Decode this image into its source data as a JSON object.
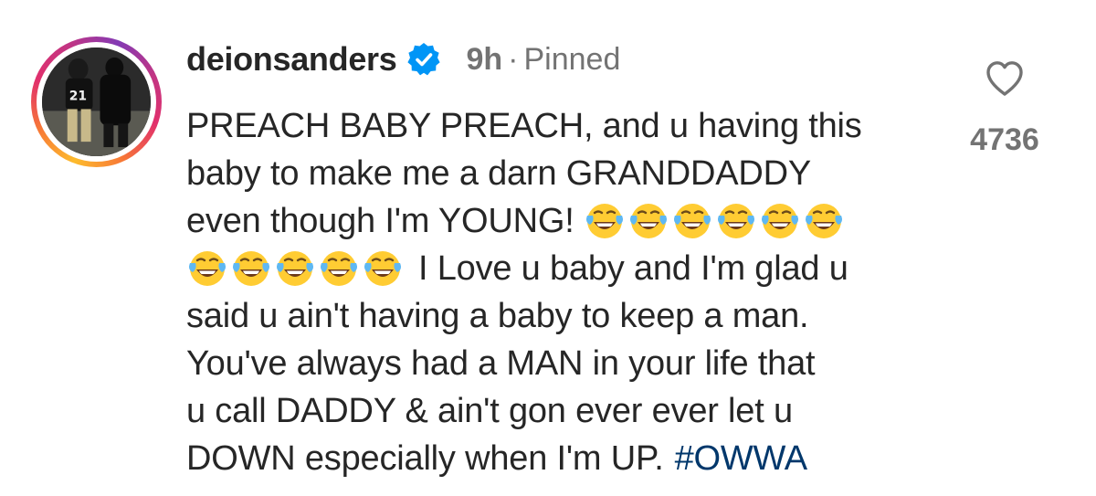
{
  "comment": {
    "username": "deionsanders",
    "verified": true,
    "time_ago": "9h",
    "separator": "·",
    "pinned_label": "Pinned",
    "avatar": {
      "jersey_number": "21"
    },
    "text_lines": [
      "PREACH BABY PREACH, and u having this",
      "baby to make me a darn GRANDDADDY",
      "even though I'm YOUNG!",
      "I Love u baby and I'm glad u",
      "said u ain't having a baby to keep a man.",
      "You've always had a MAN in your life that",
      "u call DADDY & ain't gon ever ever let u",
      "DOWN especially when I'm UP."
    ],
    "hashtag": "#OWWA",
    "emoji_name": "face-with-tears-of-joy",
    "emoji_count_line3": 6,
    "emoji_count_line4": 5,
    "like_count": "4736",
    "colors": {
      "text": "#262626",
      "secondary": "#737373",
      "hashtag": "#00376b",
      "verified_badge": "#0095f6",
      "story_ring": [
        "#fdbb2d",
        "#f77737",
        "#e1306c",
        "#c13584",
        "#833ab4"
      ]
    }
  }
}
